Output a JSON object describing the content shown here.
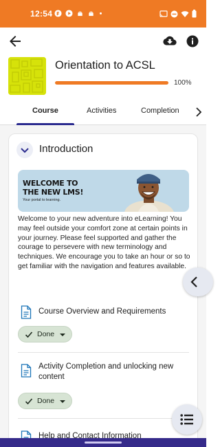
{
  "status_bar": {
    "time": "12:54",
    "left_icons": [
      "app-notification-icon",
      "play-icon",
      "android-icon",
      "android-icon",
      "dot-icon"
    ],
    "right_icons": [
      "cast-icon",
      "do-not-disturb-icon",
      "wifi-icon",
      "battery-icon"
    ],
    "background": "#ef7a24"
  },
  "app_bar": {
    "back_icon": "arrow-back-icon",
    "download_icon": "cloud-download-icon",
    "info_icon": "info-icon"
  },
  "course": {
    "title": "Orientation to ACSL",
    "progress_percent": 100,
    "progress_label": "100%",
    "thumbnail_color": "#d6e20a",
    "accent_color": "#ef7a24"
  },
  "tabs": [
    {
      "label": "Course",
      "active": true
    },
    {
      "label": "Activities",
      "active": false
    },
    {
      "label": "Completion",
      "active": false
    }
  ],
  "section": {
    "title": "Introduction",
    "banner": {
      "line1": "WELCOME TO",
      "line2": "THE NEW LMS!",
      "subtitle": "Your portal to learning."
    },
    "intro_text": "Welcome to your new adventure into eLearning! You may feel outside your comfort zone at certain points in your journey. Please feel supported and gather the courage to persevere with new terminology and techniques. We encourage you to take an hour or so to get familiar with the navigation and features available.",
    "activities": [
      {
        "name": "Course Overview and Requirements",
        "status": "Done",
        "icon": "page-icon"
      },
      {
        "name": "Activity Completion and unlocking new content",
        "status": "Done",
        "icon": "page-icon"
      },
      {
        "name": "Help and Contact Information",
        "status": "",
        "icon": "page-icon"
      }
    ]
  },
  "floating": {
    "side_toggle_icon": "chevron-left-icon",
    "course_index_icon": "list-icon"
  },
  "colors": {
    "tab_indicator": "#2b2b8f",
    "done_bg": "#d7e4d4",
    "nav_bar": "#352a8a"
  }
}
